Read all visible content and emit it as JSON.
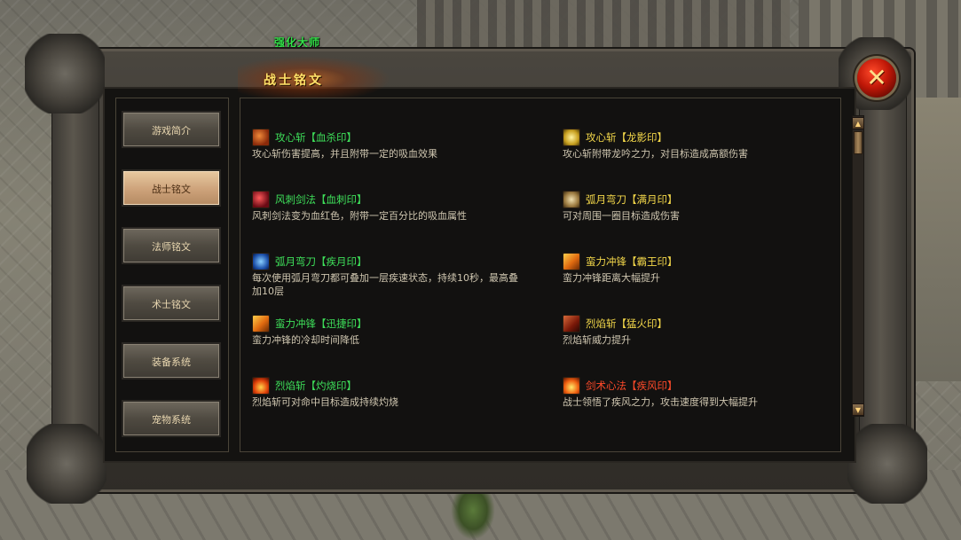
{
  "scene": {
    "npc_label": "强化大师"
  },
  "window": {
    "title": "战士铭文",
    "close_label": "✕"
  },
  "menu": {
    "items": [
      {
        "label": "游戏简介",
        "active": false
      },
      {
        "label": "战士铭文",
        "active": true
      },
      {
        "label": "法师铭文",
        "active": false
      },
      {
        "label": "术士铭文",
        "active": false
      },
      {
        "label": "装备系统",
        "active": false
      },
      {
        "label": "宠物系统",
        "active": false
      }
    ]
  },
  "entries": [
    {
      "name": "攻心斩【血杀印】",
      "desc": "攻心斩伤害提高，并且附带一定的吸血效果",
      "icon": "slash-skill-icon",
      "color": "#3ee05a"
    },
    {
      "name": "攻心斩【龙影印】",
      "desc": "攻心斩附带龙吟之力，对目标造成高额伤害",
      "icon": "dragon-skill-icon",
      "color": "#f4d84a"
    },
    {
      "name": "风刺剑法【血刺印】",
      "desc": "风刺剑法变为血红色，附带一定百分比的吸血属性",
      "icon": "blood-thrust-icon",
      "color": "#3ee05a"
    },
    {
      "name": "弧月弯刀【满月印】",
      "desc": "可对周围一圈目标造成伤害",
      "icon": "full-moon-icon",
      "color": "#f4d84a"
    },
    {
      "name": "弧月弯刀【疾月印】",
      "desc": "每次使用弧月弯刀都可叠加一层疾速状态，持续10秒，最高叠加10层",
      "icon": "swift-moon-icon",
      "color": "#3ee05a"
    },
    {
      "name": "蛮力冲锋【霸王印】",
      "desc": "蛮力冲锋距离大幅提升",
      "icon": "charge-overlord-icon",
      "color": "#f4d84a"
    },
    {
      "name": "蛮力冲锋【迅捷印】",
      "desc": "蛮力冲锋的冷却时间降低",
      "icon": "charge-swift-icon",
      "color": "#3ee05a"
    },
    {
      "name": "烈焰斩【猛火印】",
      "desc": "烈焰斩威力提升",
      "icon": "fierce-fire-icon",
      "color": "#f4d84a"
    },
    {
      "name": "烈焰斩【灼烧印】",
      "desc": "烈焰斩可对命中目标造成持续灼烧",
      "icon": "burn-icon",
      "color": "#3ee05a"
    },
    {
      "name": "剑术心法【疾风印】",
      "desc": "战士领悟了疾风之力，攻击速度得到大幅提升",
      "icon": "gale-sword-icon",
      "color": "#ff4a2a"
    }
  ],
  "scroll": {
    "up": "▲",
    "down": "▼"
  }
}
